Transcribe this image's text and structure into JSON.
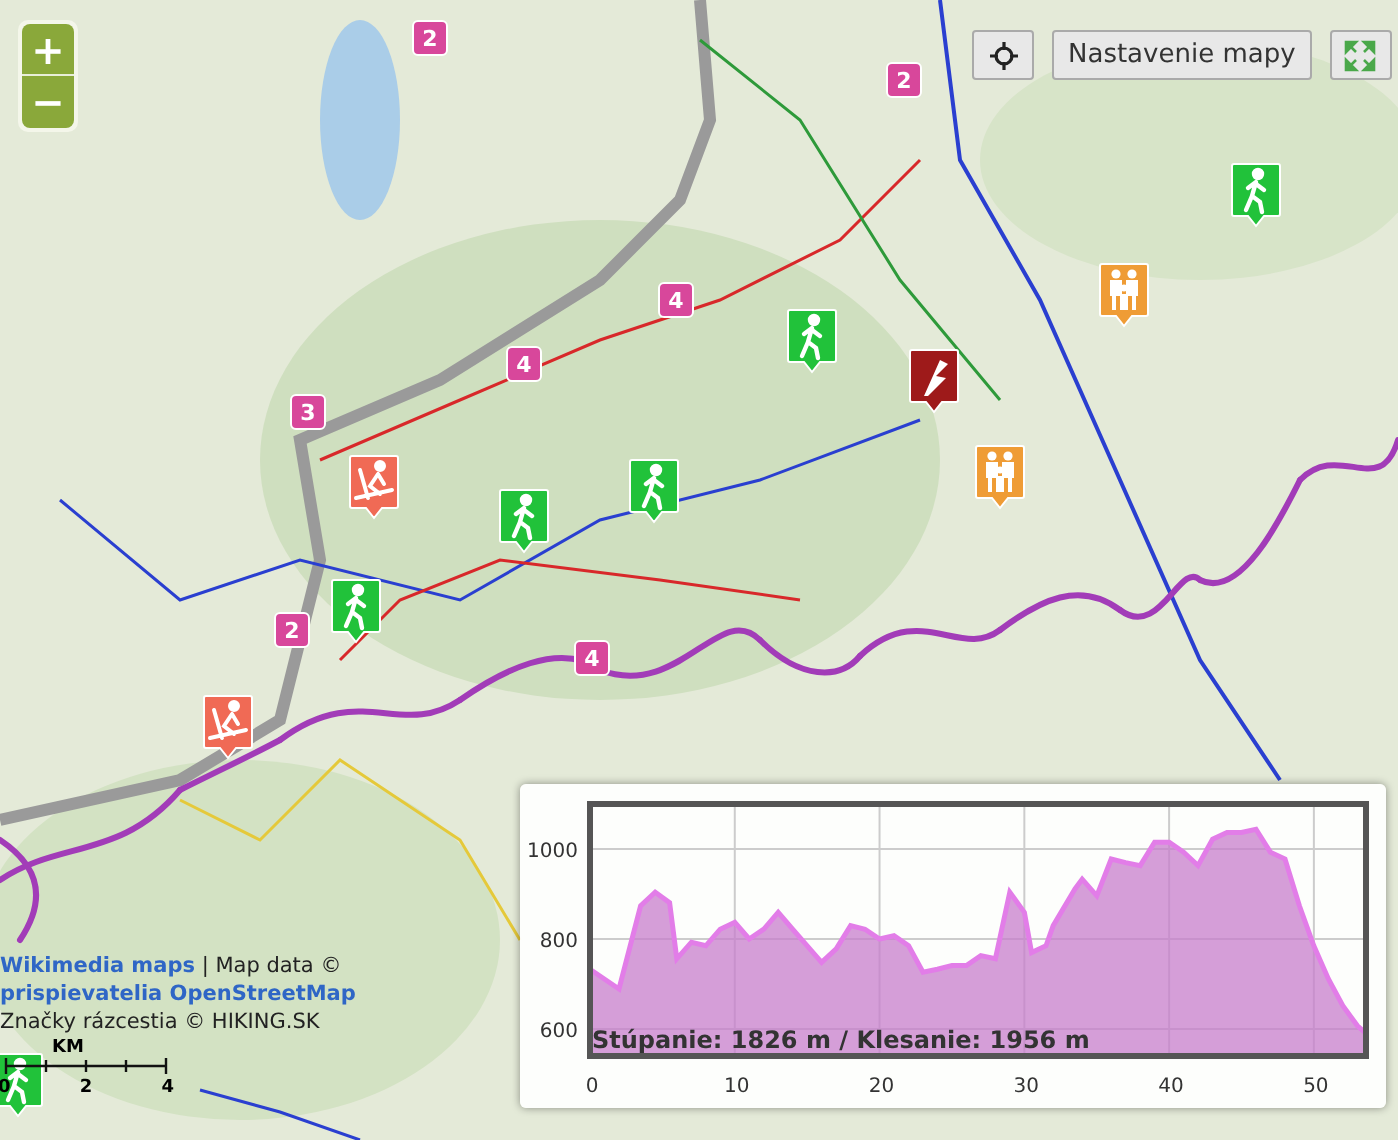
{
  "zoom_controls": {
    "zoom_in": "+",
    "zoom_out": "−"
  },
  "toolbar": {
    "settings_button": "Nastavenie mapy"
  },
  "markers": [
    {
      "kind": "number",
      "label": "2"
    },
    {
      "kind": "number",
      "label": "2"
    },
    {
      "kind": "hiker"
    },
    {
      "kind": "family"
    },
    {
      "kind": "number",
      "label": "4"
    },
    {
      "kind": "hiker"
    },
    {
      "kind": "number",
      "label": "4"
    },
    {
      "kind": "poi"
    },
    {
      "kind": "number",
      "label": "3"
    },
    {
      "kind": "skier"
    },
    {
      "kind": "hiker"
    },
    {
      "kind": "hiker"
    },
    {
      "kind": "family"
    },
    {
      "kind": "number",
      "label": "2"
    },
    {
      "kind": "hiker"
    },
    {
      "kind": "number",
      "label": "4"
    },
    {
      "kind": "skier"
    },
    {
      "kind": "hiker"
    }
  ],
  "attribution": {
    "source_link": "Wikimedia maps",
    "data_text": "| Map data ©",
    "osm_link": "prispievatelia OpenStreetMap",
    "signs_text": "Značky rázcestia © HIKING.SK"
  },
  "scale": {
    "unit": "KM",
    "ticks": [
      "0",
      "2",
      "4"
    ]
  },
  "profile": {
    "summary": "Stúpanie: 1826 m / Klesanie: 1956 m",
    "chart_data": {
      "type": "area",
      "x": [
        0,
        2,
        3.5,
        4.5,
        5.5,
        6,
        7,
        8,
        9,
        10,
        11,
        12,
        13,
        14,
        15,
        16,
        17,
        18,
        19,
        20,
        21,
        22,
        23,
        24,
        25,
        26,
        27,
        28,
        29,
        30,
        30.5,
        31.5,
        32,
        33.5,
        34,
        35,
        36,
        37,
        38,
        39,
        40,
        41,
        42,
        43,
        44,
        45,
        46,
        47,
        48,
        49,
        50,
        51,
        52,
        53,
        53.5
      ],
      "values": [
        733,
        689,
        874,
        904,
        881,
        756,
        793,
        785,
        822,
        837,
        800,
        822,
        859,
        822,
        785,
        748,
        778,
        830,
        822,
        800,
        807,
        785,
        726,
        733,
        741,
        741,
        763,
        756,
        904,
        859,
        770,
        785,
        830,
        911,
        933,
        896,
        978,
        970,
        963,
        1015,
        1015,
        993,
        963,
        1022,
        1037,
        1037,
        1044,
        993,
        978,
        874,
        785,
        711,
        652,
        607,
        593
      ],
      "xlim": [
        0,
        53.6
      ],
      "ylim": [
        540,
        1100
      ],
      "xticks": [
        0,
        10,
        20,
        30,
        40,
        50
      ],
      "yticks": [
        600,
        800,
        1000
      ],
      "grid": true
    }
  }
}
